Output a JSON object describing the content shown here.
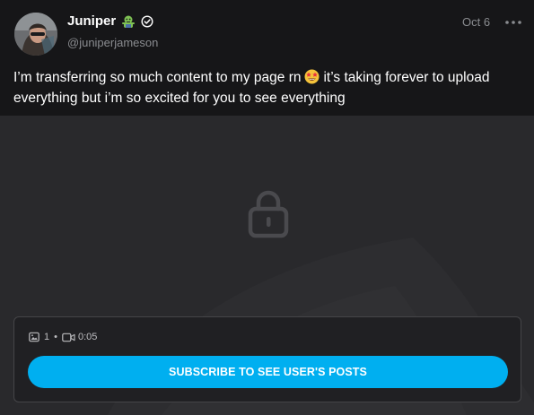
{
  "post": {
    "author": {
      "name": "Juniper",
      "handle": "@juniperjameson"
    },
    "date": "Oct 6",
    "text_before_emoji": "I’m transferring so much content to my page rn",
    "text_after_emoji": "it’s taking forever to upload everything but i’m so excited for you to see everything",
    "emoji_name": "star-struck-emoji"
  },
  "media": {
    "locked": true,
    "photos_count": "1",
    "separator": "•",
    "video_duration": "0:05"
  },
  "cta": {
    "subscribe_label": "SUBSCRIBE TO SEE USER'S POSTS"
  },
  "colors": {
    "background": "#161618",
    "media_background": "#29292c",
    "accent": "#00aff0",
    "muted_text": "#8a8c90"
  }
}
